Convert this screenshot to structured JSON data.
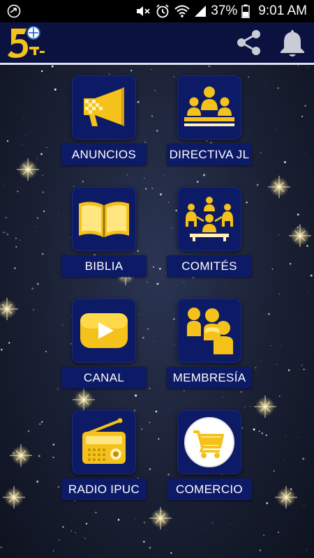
{
  "status_bar": {
    "battery_percent": "37%",
    "time": "9:01 AM"
  },
  "app_bar": {
    "logo_icon": "five-logo-icon",
    "share_icon": "share-icon",
    "notification_icon": "bell-icon"
  },
  "menu": {
    "items": [
      {
        "label": "ANUNCIOS",
        "icon": "megaphone-icon"
      },
      {
        "label": "DIRECTIVA JL",
        "icon": "board-icon"
      },
      {
        "label": "BIBLIA",
        "icon": "bible-icon"
      },
      {
        "label": "COMITÉS",
        "icon": "committee-icon"
      },
      {
        "label": "CANAL",
        "icon": "video-play-icon"
      },
      {
        "label": "MEMBRESÍA",
        "icon": "members-icon"
      },
      {
        "label": "RADIO IPUC",
        "icon": "radio-icon"
      },
      {
        "label": "COMERCIO",
        "icon": "shopping-cart-icon"
      }
    ]
  },
  "colors": {
    "tile_bg": "#0d1a66",
    "accent_gold": "#f4c21a",
    "app_bar_bg": "#0b1240"
  }
}
